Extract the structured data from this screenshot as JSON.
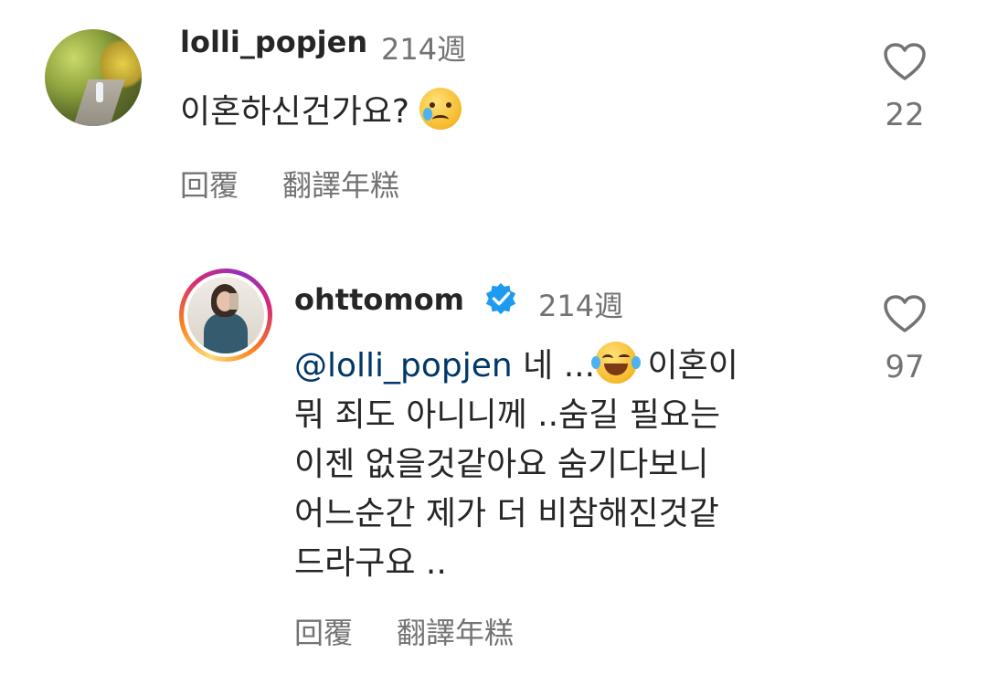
{
  "comments": [
    {
      "username": "lolli_popjen",
      "time": "214週",
      "text": "이혼하신건가요?",
      "emoji": "crying-face",
      "likes": "22",
      "reply_label": "回覆",
      "translate_label": "翻譯年糕"
    },
    {
      "username": "ohttomom",
      "verified": true,
      "time": "214週",
      "mention": "@lolli_popjen",
      "text_line1_a": " 네 ...",
      "emoji": "tears-of-joy",
      "text_line1_b": " 이혼이",
      "text_line2": "뭐 죄도 아니니께 ..숨길 필요는",
      "text_line3": "이젠 없을것같아요 숨기다보니",
      "text_line4": "어느순간 제가 더 비참해진것같",
      "text_line5": "드라구요 ..",
      "likes": "97",
      "reply_label": "回覆",
      "translate_label": "翻譯年糕"
    }
  ],
  "colors": {
    "text": "#262626",
    "secondary": "#737373",
    "mention": "#00376b",
    "verified": "#1d9bf0"
  }
}
